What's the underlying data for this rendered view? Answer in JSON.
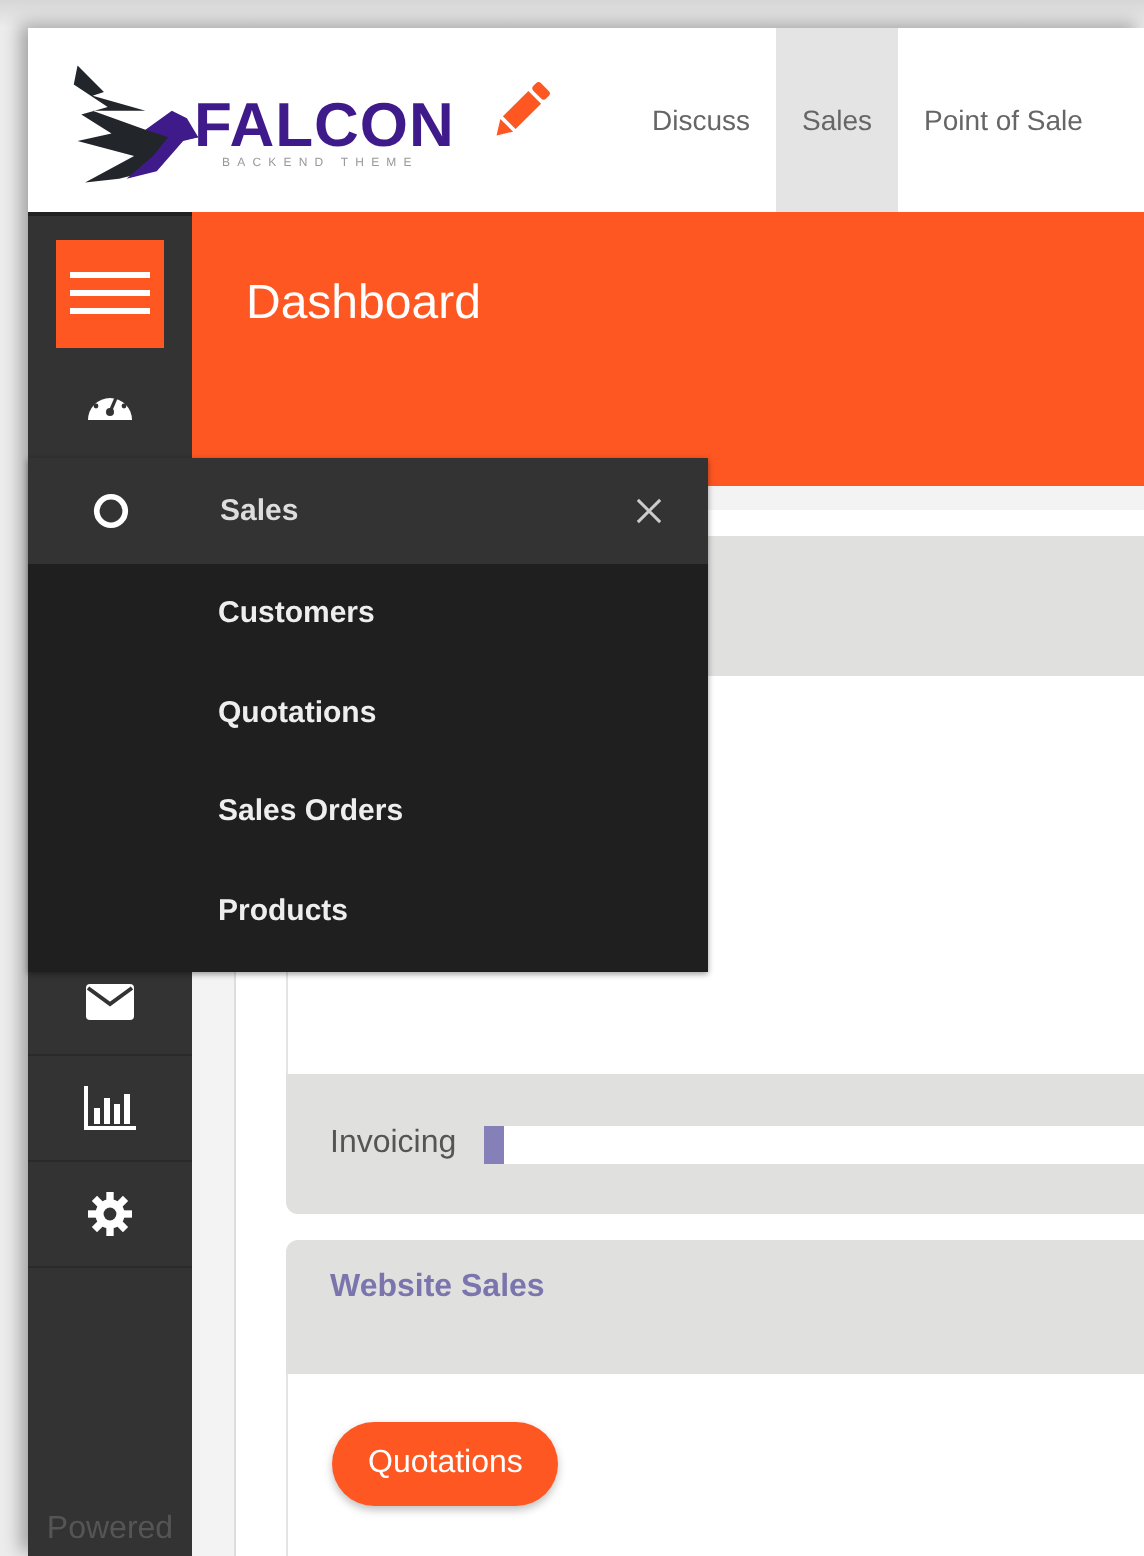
{
  "brand": {
    "name": "FALCON",
    "tagline": "BACKEND THEME"
  },
  "nav": [
    {
      "label": "Discuss",
      "selected": false
    },
    {
      "label": "Sales",
      "selected": true
    },
    {
      "label": "Point of Sale",
      "selected": false
    }
  ],
  "page_title": "Dashboard",
  "sidebar": {
    "footer": "Powered"
  },
  "flyout": {
    "title": "Sales",
    "items": [
      {
        "label": "Customers"
      },
      {
        "label": "Quotations"
      },
      {
        "label": "Sales Orders"
      },
      {
        "label": "Products"
      }
    ]
  },
  "invoicing": {
    "label": "Invoicing",
    "level": 0.03
  },
  "website_sales": {
    "title": "Website Sales",
    "button": "Quotations"
  }
}
